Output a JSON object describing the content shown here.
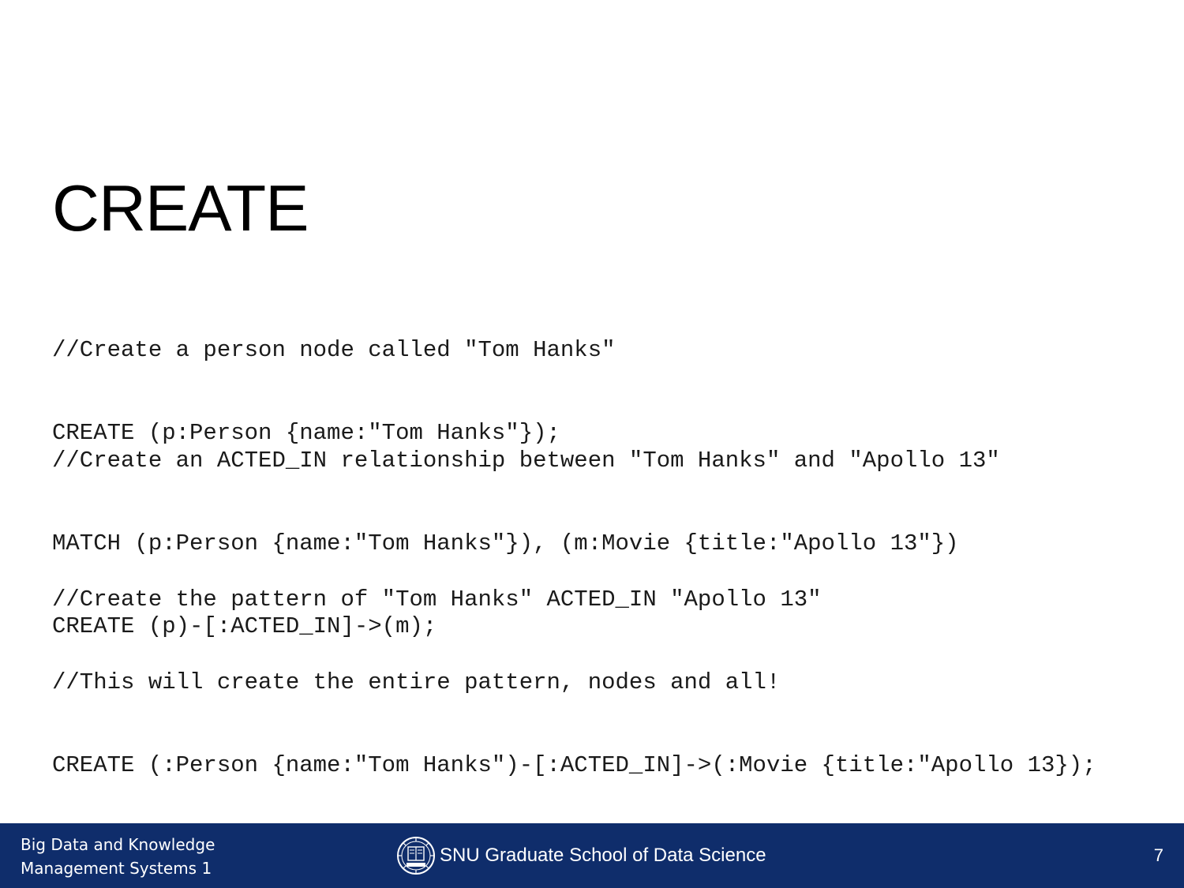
{
  "slide": {
    "title": "CREATE",
    "code_blocks": [
      {
        "lines": [
          "//Create a person node called \"Tom Hanks\"",
          "CREATE (p:Person {name:\"Tom Hanks\"});"
        ]
      },
      {
        "lines": [
          "//Create an ACTED_IN relationship between \"Tom Hanks\" and \"Apollo 13\"",
          "MATCH (p:Person {name:\"Tom Hanks\"}), (m:Movie {title:\"Apollo 13\"})",
          "CREATE (p)-[:ACTED_IN]->(m);"
        ]
      },
      {
        "lines": [
          "//Create the pattern of \"Tom Hanks\" ACTED_IN \"Apollo 13\"",
          "//This will create the entire pattern, nodes and all!",
          "CREATE (:Person {name:\"Tom Hanks\")-[:ACTED_IN]->(:Movie {title:\"Apollo 13});"
        ]
      }
    ]
  },
  "footer": {
    "course_line_1": "Big Data and Knowledge",
    "course_line_2": "Management Systems 1",
    "school": "SNU Graduate School of Data Science",
    "logo_icon": "snu-seal-icon",
    "page_number": "7",
    "background_color": "#0f2d6b"
  }
}
